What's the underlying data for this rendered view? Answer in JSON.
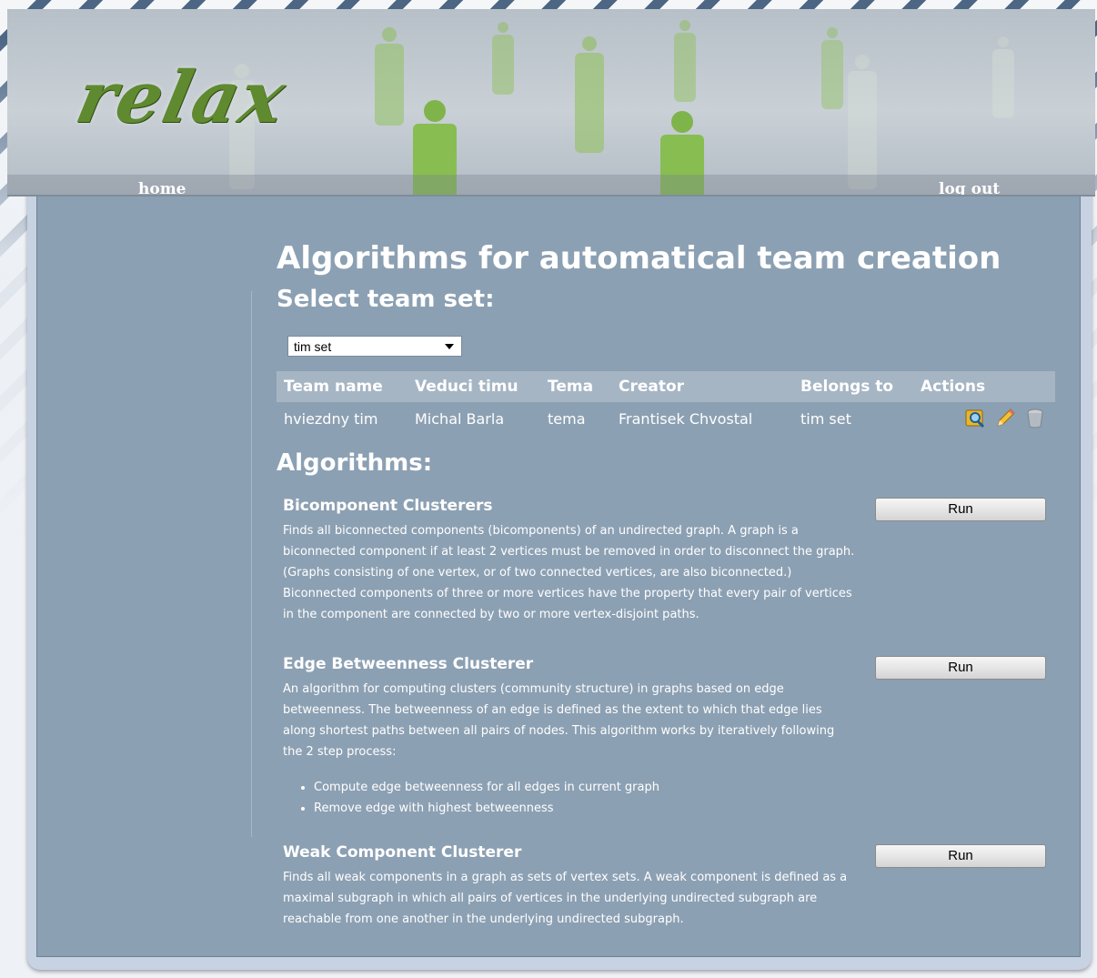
{
  "header": {
    "logo_text": "relax",
    "home_link": "home",
    "logout_link": "log out"
  },
  "main": {
    "title": "Algorithms for automatical team creation",
    "select_heading": "Select team set:",
    "team_set_select": {
      "selected": "tim set"
    },
    "table": {
      "columns": [
        "Team name",
        "Veduci timu",
        "Tema",
        "Creator",
        "Belongs to",
        "Actions"
      ],
      "rows": [
        {
          "team_name": "hviezdny tim",
          "leader": "Michal Barla",
          "topic": "tema",
          "creator": "Frantisek Chvostal",
          "belongs_to": "tim set",
          "actions": [
            "view-icon",
            "edit-icon",
            "delete-icon"
          ]
        }
      ]
    },
    "algorithms_heading": "Algorithms:",
    "algorithms": [
      {
        "name": "Bicomponent Clusterers",
        "description": "Finds all biconnected components (bicomponents) of an undirected graph. A graph is a biconnected component if at least 2 vertices must be removed in order to disconnect the graph. (Graphs consisting of one vertex, or of two connected vertices, are also biconnected.) Biconnected components of three or more vertices have the property that every pair of vertices in the component are connected by two or more vertex-disjoint paths.",
        "run_label": "Run"
      },
      {
        "name": "Edge Betweenness Clusterer",
        "description": "An algorithm for computing clusters (community structure) in graphs based on edge betweenness. The betweenness of an edge is defined as the extent to which that edge lies along shortest paths between all pairs of nodes. This algorithm works by iteratively following the 2 step process:",
        "steps": [
          "Compute edge betweenness for all edges in current graph",
          "Remove edge with highest betweenness"
        ],
        "run_label": "Run"
      },
      {
        "name": "Weak Component Clusterer",
        "description": "Finds all weak components in a graph as sets of vertex sets. A weak component is defined as a maximal subgraph in which all pairs of vertices in the underlying undirected subgraph are reachable from one another in the underlying undirected subgraph.",
        "run_label": "Run"
      }
    ]
  },
  "colors": {
    "page_background": "#8ca0b3",
    "table_header": "#a6b5c4",
    "logo_green": "#5f8a2f"
  }
}
